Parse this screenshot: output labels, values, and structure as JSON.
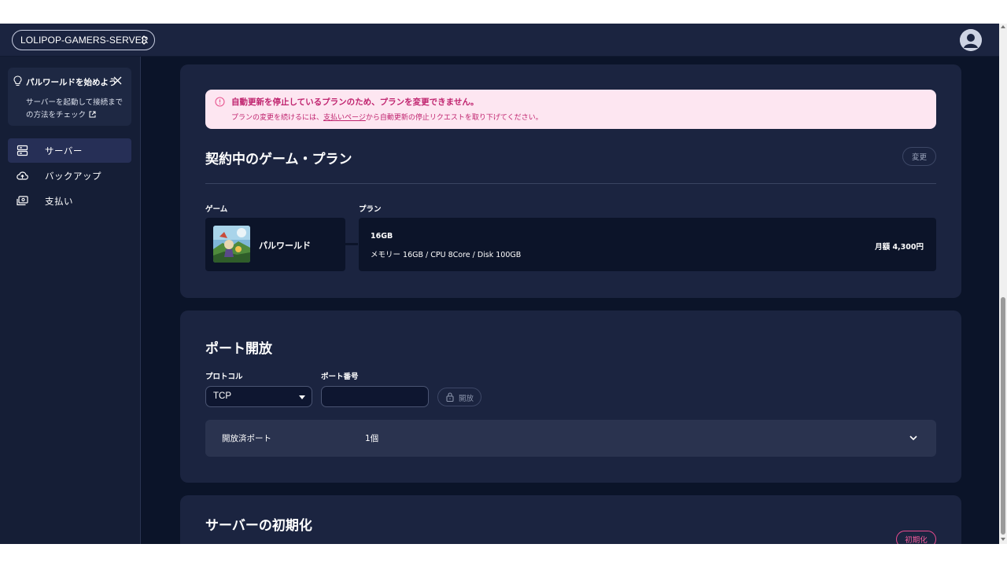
{
  "header": {
    "server_name": "LOLIPOP-GAMERS-SERVER"
  },
  "sidebar": {
    "tip": {
      "title": "パルワールドを始めよう",
      "body": "サーバーを起動して接続までの方法をチェック"
    },
    "items": [
      {
        "label": "サーバー",
        "icon": "server-icon",
        "active": true
      },
      {
        "label": "バックアップ",
        "icon": "cloud-upload-icon",
        "active": false
      },
      {
        "label": "支払い",
        "icon": "payment-icon",
        "active": false
      }
    ]
  },
  "plan_card": {
    "alert": {
      "title": "自動更新を停止しているプランのため、プランを変更できません。",
      "body_before": "プランの変更を続けるには、",
      "body_link": "支払いページ",
      "body_after": "から自動更新の停止リクエストを取り下げてください。"
    },
    "title": "契約中のゲーム・プラン",
    "change_button": "変更",
    "game_label": "ゲーム",
    "plan_label": "プラン",
    "game_name": "パルワールド",
    "plan_name": "16GB",
    "plan_spec": "メモリー 16GB / CPU 8Core / Disk 100GB",
    "plan_price": "月額  4,300円"
  },
  "port_card": {
    "title": "ポート開放",
    "protocol_label": "プロトコル",
    "protocol_value": "TCP",
    "port_label": "ポート番号",
    "port_value": "",
    "open_button": "開放",
    "opened_ports_label": "開放済ポート",
    "opened_ports_count": "1個"
  },
  "reset_card": {
    "title": "サーバーの初期化",
    "reset_button": "初期化"
  },
  "colors": {
    "background": "#0b1429",
    "card": "#1b2440",
    "alert_bg": "#fde6f1",
    "alert_text": "#c0246f",
    "danger": "#e84b8f"
  }
}
